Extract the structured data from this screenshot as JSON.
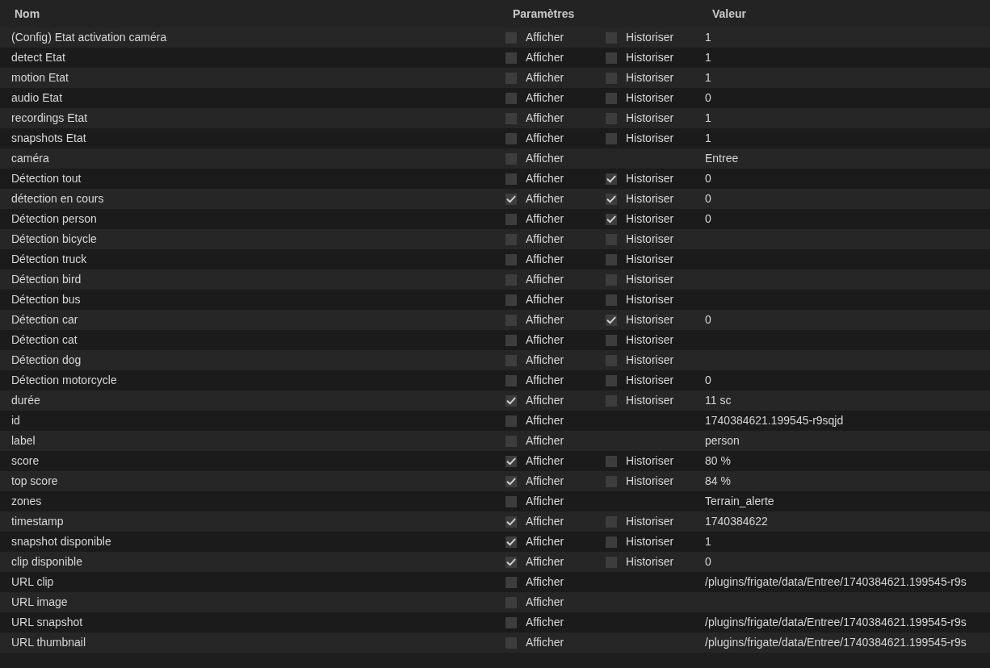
{
  "table": {
    "columns": [
      "Nom",
      "Paramètres",
      "Valeur"
    ],
    "rows": [
      {
        "name": "(Config) Etat activation caméra",
        "afficher": {
          "label": "Afficher",
          "checked": false
        },
        "historiser": {
          "label": "Historiser",
          "checked": false
        },
        "value": "1"
      },
      {
        "name": "detect Etat",
        "afficher": {
          "label": "Afficher",
          "checked": false
        },
        "historiser": {
          "label": "Historiser",
          "checked": false
        },
        "value": "1"
      },
      {
        "name": "motion Etat",
        "afficher": {
          "label": "Afficher",
          "checked": false
        },
        "historiser": {
          "label": "Historiser",
          "checked": false
        },
        "value": "1"
      },
      {
        "name": "audio Etat",
        "afficher": {
          "label": "Afficher",
          "checked": false
        },
        "historiser": {
          "label": "Historiser",
          "checked": false
        },
        "value": "0"
      },
      {
        "name": "recordings Etat",
        "afficher": {
          "label": "Afficher",
          "checked": false
        },
        "historiser": {
          "label": "Historiser",
          "checked": false
        },
        "value": "1"
      },
      {
        "name": "snapshots Etat",
        "afficher": {
          "label": "Afficher",
          "checked": false
        },
        "historiser": {
          "label": "Historiser",
          "checked": false
        },
        "value": "1"
      },
      {
        "name": "caméra",
        "afficher": {
          "label": "Afficher",
          "checked": false
        },
        "value": "Entree"
      },
      {
        "name": "Détection tout",
        "afficher": {
          "label": "Afficher",
          "checked": false
        },
        "historiser": {
          "label": "Historiser",
          "checked": true
        },
        "value": "0"
      },
      {
        "name": "détection en cours",
        "afficher": {
          "label": "Afficher",
          "checked": true
        },
        "historiser": {
          "label": "Historiser",
          "checked": true
        },
        "value": "0"
      },
      {
        "name": "Détection person",
        "afficher": {
          "label": "Afficher",
          "checked": false
        },
        "historiser": {
          "label": "Historiser",
          "checked": true
        },
        "value": "0"
      },
      {
        "name": "Détection bicycle",
        "afficher": {
          "label": "Afficher",
          "checked": false
        },
        "historiser": {
          "label": "Historiser",
          "checked": false
        }
      },
      {
        "name": "Détection truck",
        "afficher": {
          "label": "Afficher",
          "checked": false
        },
        "historiser": {
          "label": "Historiser",
          "checked": false
        }
      },
      {
        "name": "Détection bird",
        "afficher": {
          "label": "Afficher",
          "checked": false
        },
        "historiser": {
          "label": "Historiser",
          "checked": false
        }
      },
      {
        "name": "Détection bus",
        "afficher": {
          "label": "Afficher",
          "checked": false
        },
        "historiser": {
          "label": "Historiser",
          "checked": false
        }
      },
      {
        "name": "Détection car",
        "afficher": {
          "label": "Afficher",
          "checked": false
        },
        "historiser": {
          "label": "Historiser",
          "checked": true
        },
        "value": "0"
      },
      {
        "name": "Détection cat",
        "afficher": {
          "label": "Afficher",
          "checked": false
        },
        "historiser": {
          "label": "Historiser",
          "checked": false
        }
      },
      {
        "name": "Détection dog",
        "afficher": {
          "label": "Afficher",
          "checked": false
        },
        "historiser": {
          "label": "Historiser",
          "checked": false
        }
      },
      {
        "name": "Détection motorcycle",
        "afficher": {
          "label": "Afficher",
          "checked": false
        },
        "historiser": {
          "label": "Historiser",
          "checked": false
        },
        "value": "0"
      },
      {
        "name": "durée",
        "afficher": {
          "label": "Afficher",
          "checked": true
        },
        "historiser": {
          "label": "Historiser",
          "checked": false
        },
        "value": "11 sc"
      },
      {
        "name": "id",
        "afficher": {
          "label": "Afficher",
          "checked": false
        },
        "value": "1740384621.199545-r9sqjd"
      },
      {
        "name": "label",
        "afficher": {
          "label": "Afficher",
          "checked": false
        },
        "value": "person"
      },
      {
        "name": "score",
        "afficher": {
          "label": "Afficher",
          "checked": true
        },
        "historiser": {
          "label": "Historiser",
          "checked": false
        },
        "value": "80 %"
      },
      {
        "name": "top score",
        "afficher": {
          "label": "Afficher",
          "checked": true
        },
        "historiser": {
          "label": "Historiser",
          "checked": false
        },
        "value": "84 %"
      },
      {
        "name": "zones",
        "afficher": {
          "label": "Afficher",
          "checked": false
        },
        "value": "Terrain_alerte"
      },
      {
        "name": "timestamp",
        "afficher": {
          "label": "Afficher",
          "checked": true
        },
        "historiser": {
          "label": "Historiser",
          "checked": false
        },
        "value": "1740384622"
      },
      {
        "name": "snapshot disponible",
        "afficher": {
          "label": "Afficher",
          "checked": true
        },
        "historiser": {
          "label": "Historiser",
          "checked": false
        },
        "value": "1"
      },
      {
        "name": "clip disponible",
        "afficher": {
          "label": "Afficher",
          "checked": true
        },
        "historiser": {
          "label": "Historiser",
          "checked": false
        },
        "value": "0"
      },
      {
        "name": "URL clip",
        "afficher": {
          "label": "Afficher",
          "checked": false
        },
        "value": "/plugins/frigate/data/Entree/1740384621.199545-r9s"
      },
      {
        "name": "URL image",
        "afficher": {
          "label": "Afficher",
          "checked": false
        }
      },
      {
        "name": "URL snapshot",
        "afficher": {
          "label": "Afficher",
          "checked": false
        },
        "value": "/plugins/frigate/data/Entree/1740384621.199545-r9s"
      },
      {
        "name": "URL thumbnail",
        "afficher": {
          "label": "Afficher",
          "checked": false
        },
        "value": "/plugins/frigate/data/Entree/1740384621.199545-r9s"
      }
    ]
  }
}
